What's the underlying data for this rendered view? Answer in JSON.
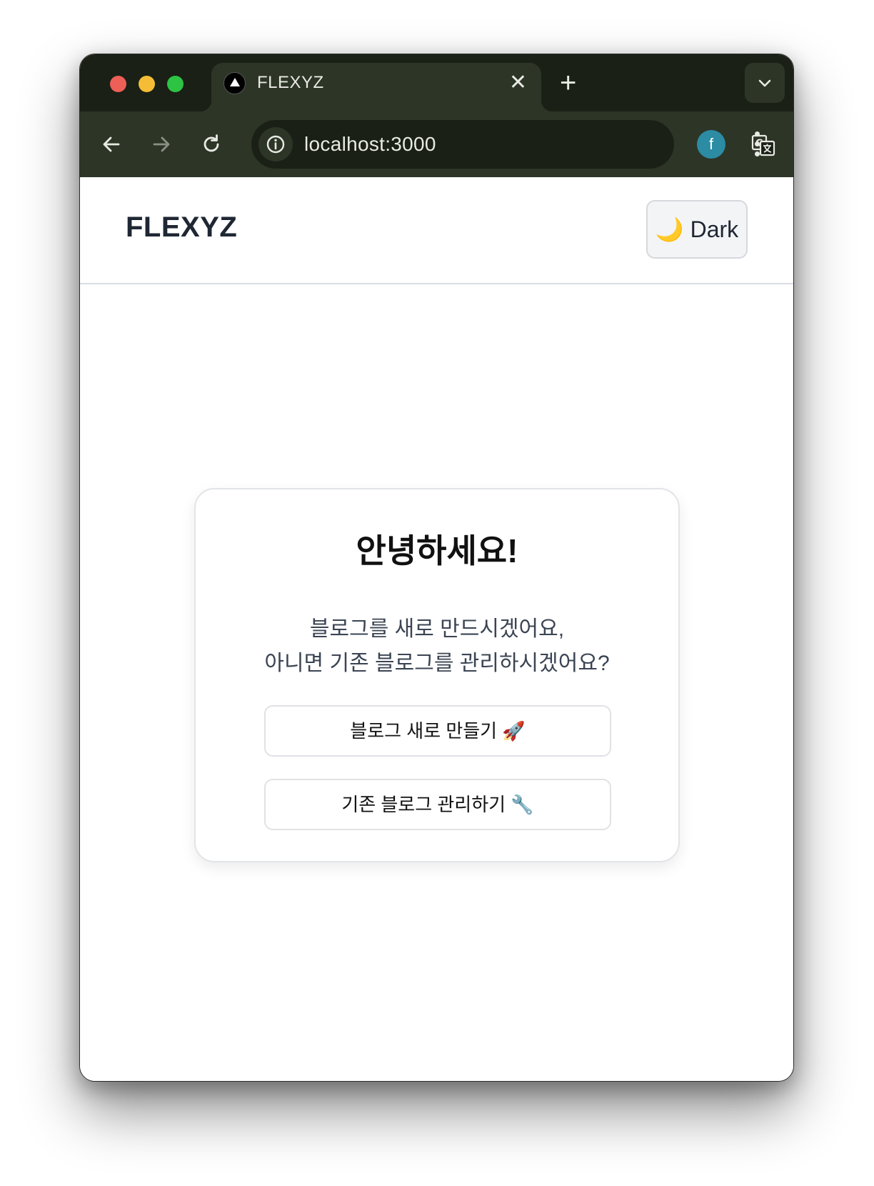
{
  "browser": {
    "tab_title": "FLEXYZ",
    "tab_close": "✕",
    "new_tab": "+",
    "url": "localhost:3000",
    "profile_initial": "f",
    "icons": [
      "close-icon",
      "plus-icon",
      "chevron-down-icon",
      "back-icon",
      "forward-icon",
      "reload-icon",
      "info-icon",
      "translate-icon",
      "star-icon",
      "menu-icon"
    ]
  },
  "header": {
    "brand": "FLEXYZ",
    "theme_toggle": "🌙 Dark"
  },
  "card": {
    "title": "안녕하세요!",
    "description_line1": "블로그를 새로 만드시겠어요,",
    "description_line2": "아니면 기존 블로그를 관리하시겠어요?",
    "create_button": "블로그 새로 만들기 🚀",
    "manage_button": "기존 블로그 관리하기 🔧"
  },
  "colors": {
    "chrome_dark": "#1a2016",
    "chrome_toolbar": "#2d3527",
    "avatar": "#2b8ca3",
    "text_dark": "#1f2733"
  }
}
